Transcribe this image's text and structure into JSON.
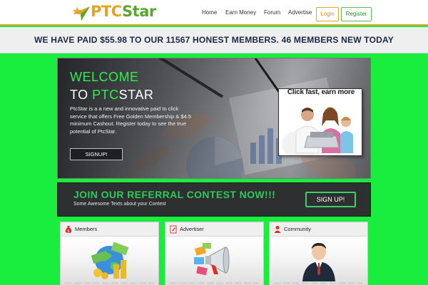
{
  "header": {
    "logo": {
      "part1": "PTC",
      "part2": "Star",
      "icon": "star-icon"
    },
    "nav": [
      {
        "label": "Home"
      },
      {
        "label": "Earn Money"
      },
      {
        "label": "Forum"
      },
      {
        "label": "Advertise"
      }
    ],
    "login_label": "Login",
    "register_label": "Register"
  },
  "banner": {
    "text": "WE HAVE PAID $55.98 TO OUR 11567 HONEST MEMBERS. 46 MEMBERS NEW TODAY"
  },
  "hero": {
    "title_line1": "WELCOME",
    "title_line2_pre": "TO ",
    "title_line2_ptc": "PTC",
    "title_line2_rest": "STAR",
    "description": "PtcStar is a a new and innovative paid to click service that offers Free Golden Membership & $4.5 minimum Cashout. Register today to see the true potential of PtcStar.",
    "signup_label": "SIGNUP!",
    "card_label": "Click fast, earn more"
  },
  "contest": {
    "title": "JOIN OUR REFERRAL CONTEST NOW!!!",
    "subtitle": "Some Awesome Texts about your Contest",
    "button_label": "SIGN UP!"
  },
  "panels": [
    {
      "label": "Members",
      "icon": "money-bag-icon",
      "image": "globe-money-icon"
    },
    {
      "label": "Advertiser",
      "icon": "pencil-doc-icon",
      "image": "megaphone-icon"
    },
    {
      "label": "Community",
      "icon": "person-icon",
      "image": "businessman-icon"
    }
  ],
  "colors": {
    "page_bg": "#19ee3f",
    "accent_green": "#2ef04a",
    "accent_orange": "#e6a52a",
    "banner_text": "#1b2744",
    "contest_bg": "#2e2f31"
  }
}
